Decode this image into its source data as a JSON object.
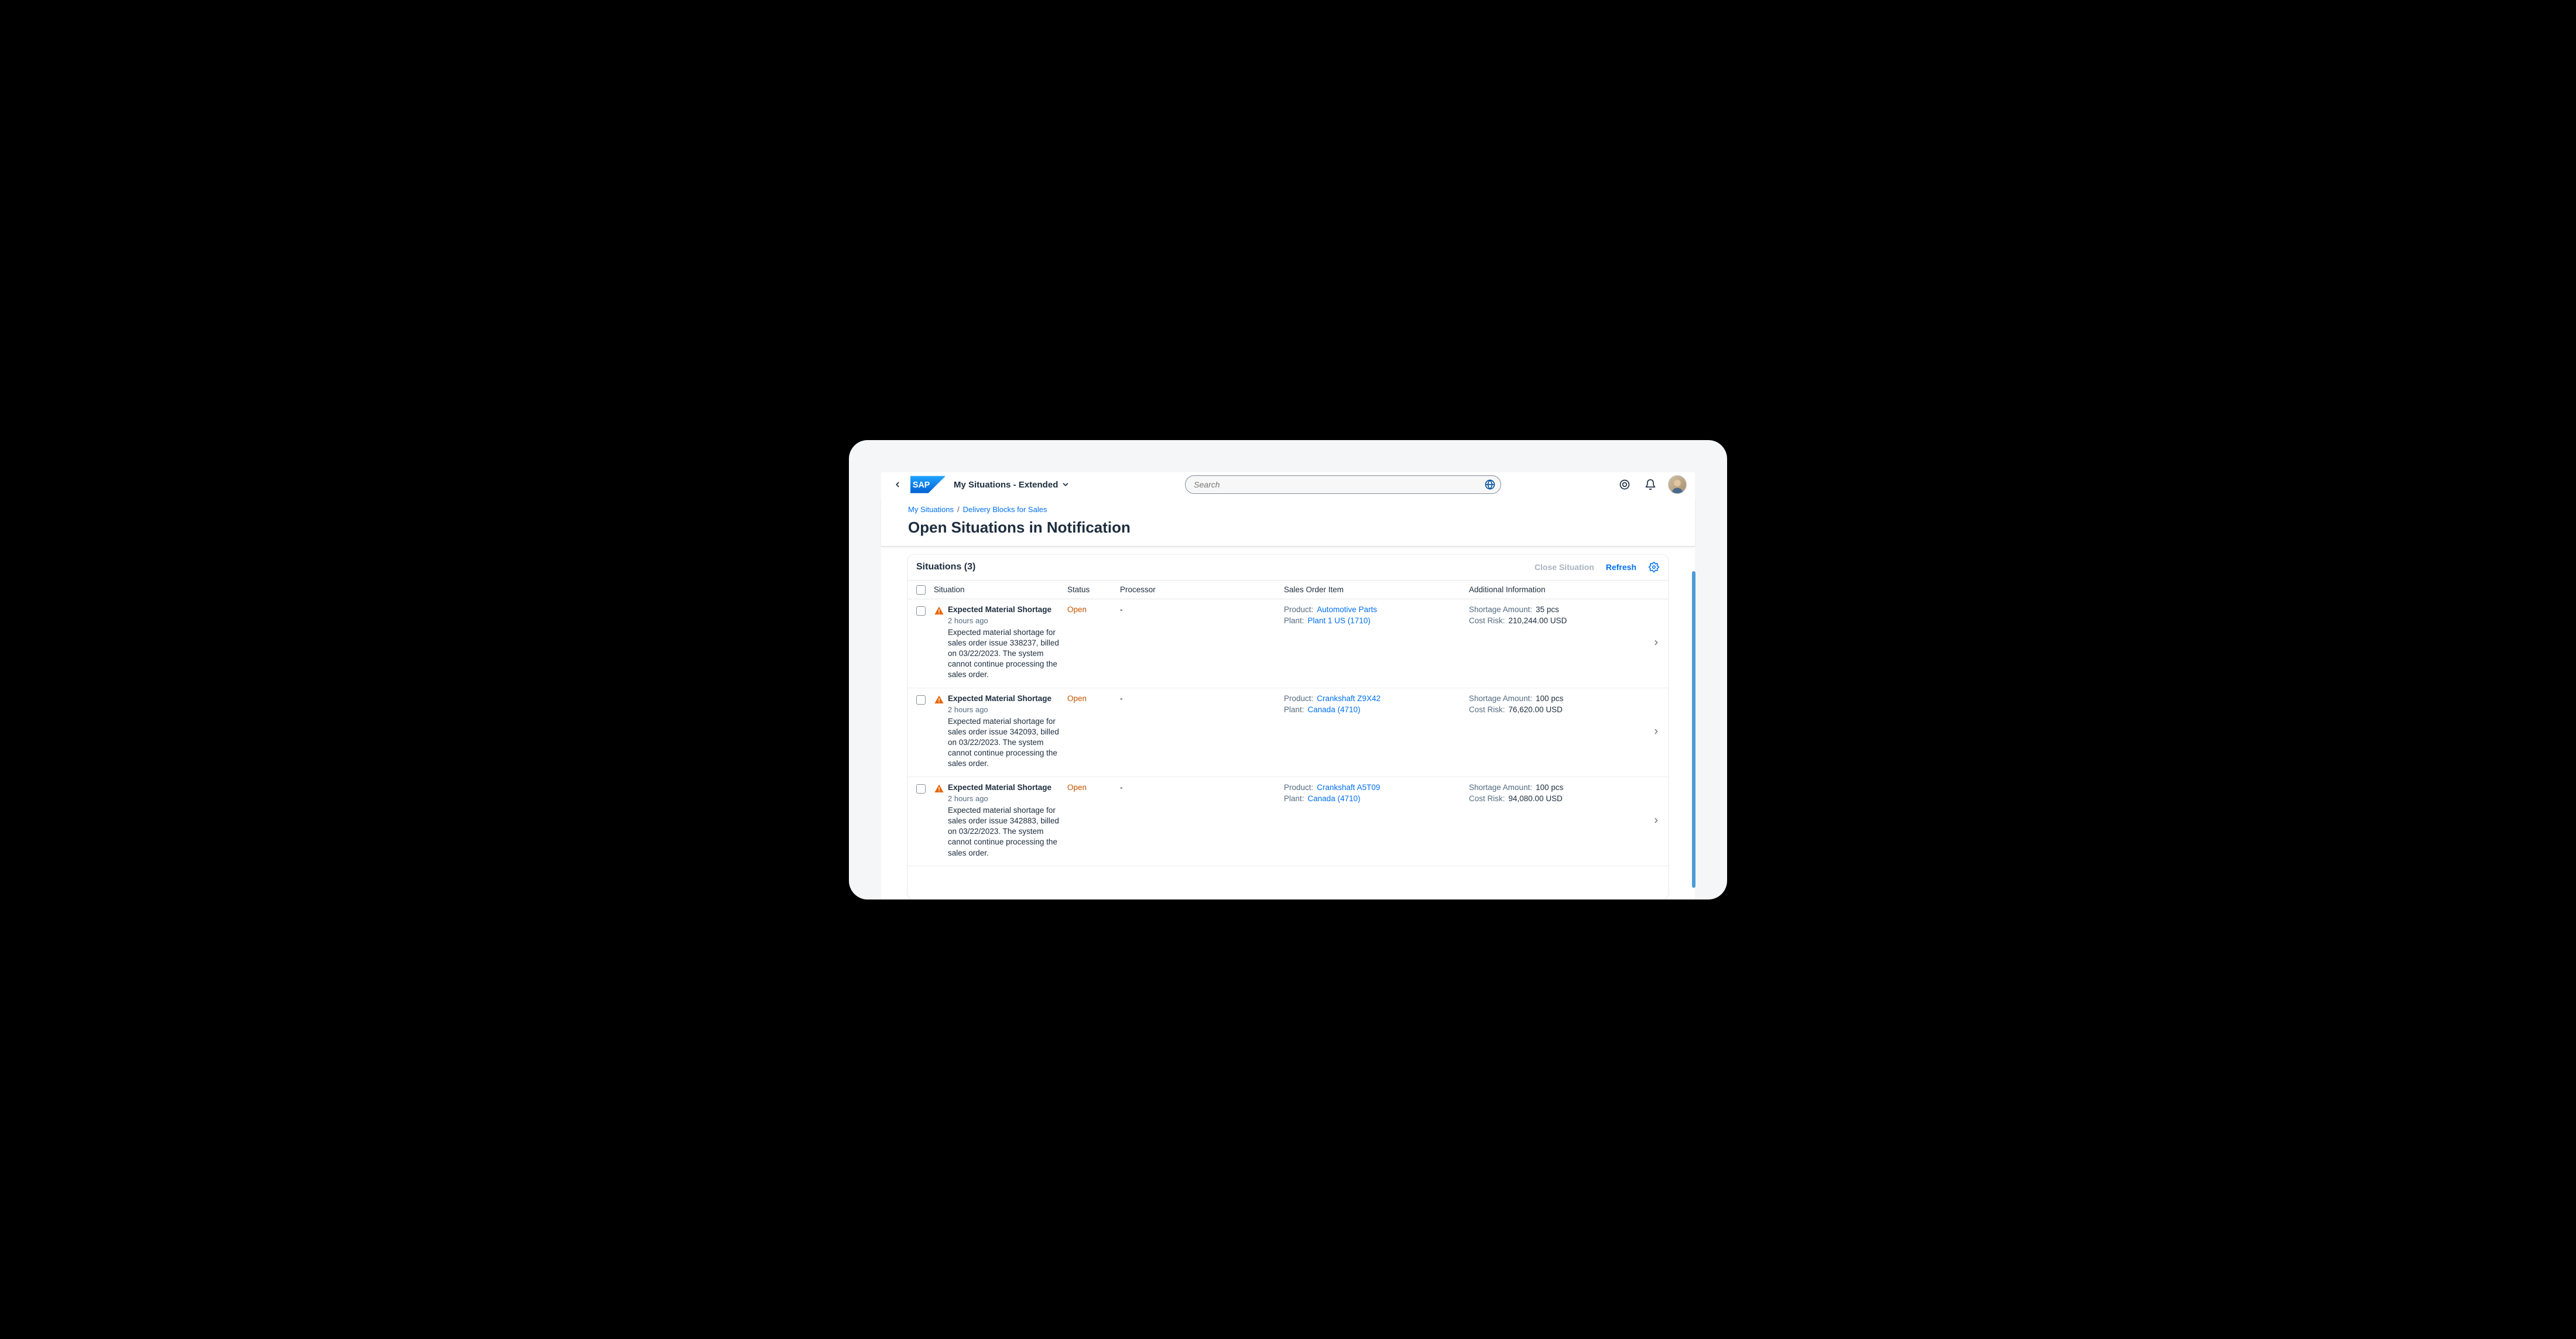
{
  "shell": {
    "product_title": "My Situations - Extended",
    "search_placeholder": "Search"
  },
  "breadcrumb": {
    "items": [
      "My Situations",
      "Delivery Blocks for Sales"
    ]
  },
  "page": {
    "title": "Open Situations in Notification"
  },
  "table": {
    "title": "Situations (3)",
    "actions": {
      "close_label": "Close Situation",
      "refresh_label": "Refresh"
    },
    "columns": {
      "situation": "Situation",
      "status": "Status",
      "processor": "Processor",
      "sales_order_item": "Sales Order Item",
      "additional_info": "Additional Information"
    },
    "labels": {
      "product": "Product:",
      "plant": "Plant:",
      "shortage": "Shortage Amount:",
      "cost_risk": "Cost Risk:"
    },
    "rows": [
      {
        "title": "Expected Material Shortage",
        "time": "2 hours ago",
        "desc": "Expected material shortage for sales order issue 338237, billed on 03/22/2023. The system cannot continue processing the sales order.",
        "status": "Open",
        "processor": "-",
        "product": "Automotive Parts",
        "plant": "Plant 1 US (1710)",
        "shortage": "35 pcs",
        "cost_risk": "210,244.00 USD"
      },
      {
        "title": "Expected Material Shortage",
        "time": "2 hours ago",
        "desc": "Expected material shortage for sales order issue 342093, billed on 03/22/2023. The system cannot continue processing the sales order.",
        "status": "Open",
        "processor": "-",
        "product": "Crankshaft Z9X42",
        "plant": "Canada (4710)",
        "shortage": "100 pcs",
        "cost_risk": "76,620.00 USD"
      },
      {
        "title": "Expected Material Shortage",
        "time": "2 hours ago",
        "desc": "Expected material shortage for sales order issue 342883, billed on 03/22/2023. The system cannot continue processing the sales order.",
        "status": "Open",
        "processor": "-",
        "product": "Crankshaft A5T09",
        "plant": "Canada (4710)",
        "shortage": "100 pcs",
        "cost_risk": "94,080.00 USD"
      }
    ]
  }
}
